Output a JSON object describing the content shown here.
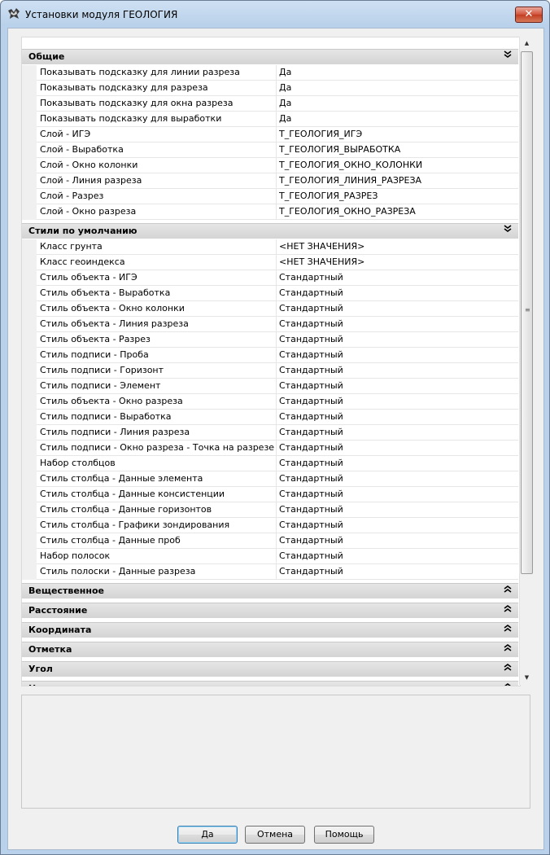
{
  "window": {
    "title": "Установки модуля ГЕОЛОГИЯ",
    "close_label": "✕"
  },
  "icons": {
    "app": "geology-app-icon",
    "collapse": "chevrons-down-icon",
    "expand": "chevrons-up-icon"
  },
  "categories": [
    {
      "label": "Общие",
      "expanded": true,
      "rows": [
        {
          "name": "Показывать подсказку для линии разреза",
          "value": "Да"
        },
        {
          "name": "Показывать подсказку для разреза",
          "value": "Да"
        },
        {
          "name": "Показывать подсказку для окна разреза",
          "value": "Да"
        },
        {
          "name": "Показывать подсказку для выработки",
          "value": "Да"
        },
        {
          "name": "Слой - ИГЭ",
          "value": "Т_ГЕОЛОГИЯ_ИГЭ"
        },
        {
          "name": "Слой - Выработка",
          "value": "Т_ГЕОЛОГИЯ_ВЫРАБОТКА"
        },
        {
          "name": "Слой - Окно колонки",
          "value": "Т_ГЕОЛОГИЯ_ОКНО_КОЛОНКИ"
        },
        {
          "name": "Слой - Линия разреза",
          "value": "Т_ГЕОЛОГИЯ_ЛИНИЯ_РАЗРЕЗА"
        },
        {
          "name": "Слой - Разрез",
          "value": "Т_ГЕОЛОГИЯ_РАЗРЕЗ"
        },
        {
          "name": "Слой - Окно разреза",
          "value": "Т_ГЕОЛОГИЯ_ОКНО_РАЗРЕЗА"
        }
      ]
    },
    {
      "label": "Стили по умолчанию",
      "expanded": true,
      "rows": [
        {
          "name": "Класс грунта",
          "value": "<НЕТ ЗНАЧЕНИЯ>"
        },
        {
          "name": "Класс геоиндекса",
          "value": "<НЕТ ЗНАЧЕНИЯ>"
        },
        {
          "name": "Стиль объекта - ИГЭ",
          "value": "Стандартный"
        },
        {
          "name": "Стиль объекта - Выработка",
          "value": "Стандартный"
        },
        {
          "name": "Стиль объекта - Окно колонки",
          "value": "Стандартный"
        },
        {
          "name": "Стиль объекта - Линия разреза",
          "value": "Стандартный"
        },
        {
          "name": "Стиль объекта - Разрез",
          "value": "Стандартный"
        },
        {
          "name": "Стиль подписи - Проба",
          "value": "Стандартный"
        },
        {
          "name": "Стиль подписи - Горизонт",
          "value": "Стандартный"
        },
        {
          "name": "Стиль подписи - Элемент",
          "value": "Стандартный"
        },
        {
          "name": "Стиль объекта - Окно разреза",
          "value": "Стандартный"
        },
        {
          "name": "Стиль подписи - Выработка",
          "value": "Стандартный"
        },
        {
          "name": "Стиль подписи - Линия разреза",
          "value": "Стандартный"
        },
        {
          "name": "Стиль подписи - Окно разреза - Точка на разрезе",
          "value": "Стандартный"
        },
        {
          "name": "Набор столбцов",
          "value": "Стандартный"
        },
        {
          "name": "Стиль столбца - Данные элемента",
          "value": "Стандартный"
        },
        {
          "name": "Стиль столбца - Данные консистенции",
          "value": "Стандартный"
        },
        {
          "name": "Стиль столбца - Данные горизонтов",
          "value": "Стандартный"
        },
        {
          "name": "Стиль столбца - Графики зондирования",
          "value": "Стандартный"
        },
        {
          "name": "Стиль столбца - Данные проб",
          "value": "Стандартный"
        },
        {
          "name": "Набор полосок",
          "value": "Стандартный"
        },
        {
          "name": "Стиль полоски - Данные разреза",
          "value": "Стандартный"
        }
      ]
    },
    {
      "label": "Вещественное",
      "expanded": false,
      "rows": []
    },
    {
      "label": "Расстояние",
      "expanded": false,
      "rows": []
    },
    {
      "label": "Координата",
      "expanded": false,
      "rows": []
    },
    {
      "label": "Отметка",
      "expanded": false,
      "rows": []
    },
    {
      "label": "Угол",
      "expanded": false,
      "rows": []
    },
    {
      "label": "Направление",
      "expanded": false,
      "rows": []
    }
  ],
  "buttons": {
    "ok": "Да",
    "cancel": "Отмена",
    "help": "Помощь"
  }
}
